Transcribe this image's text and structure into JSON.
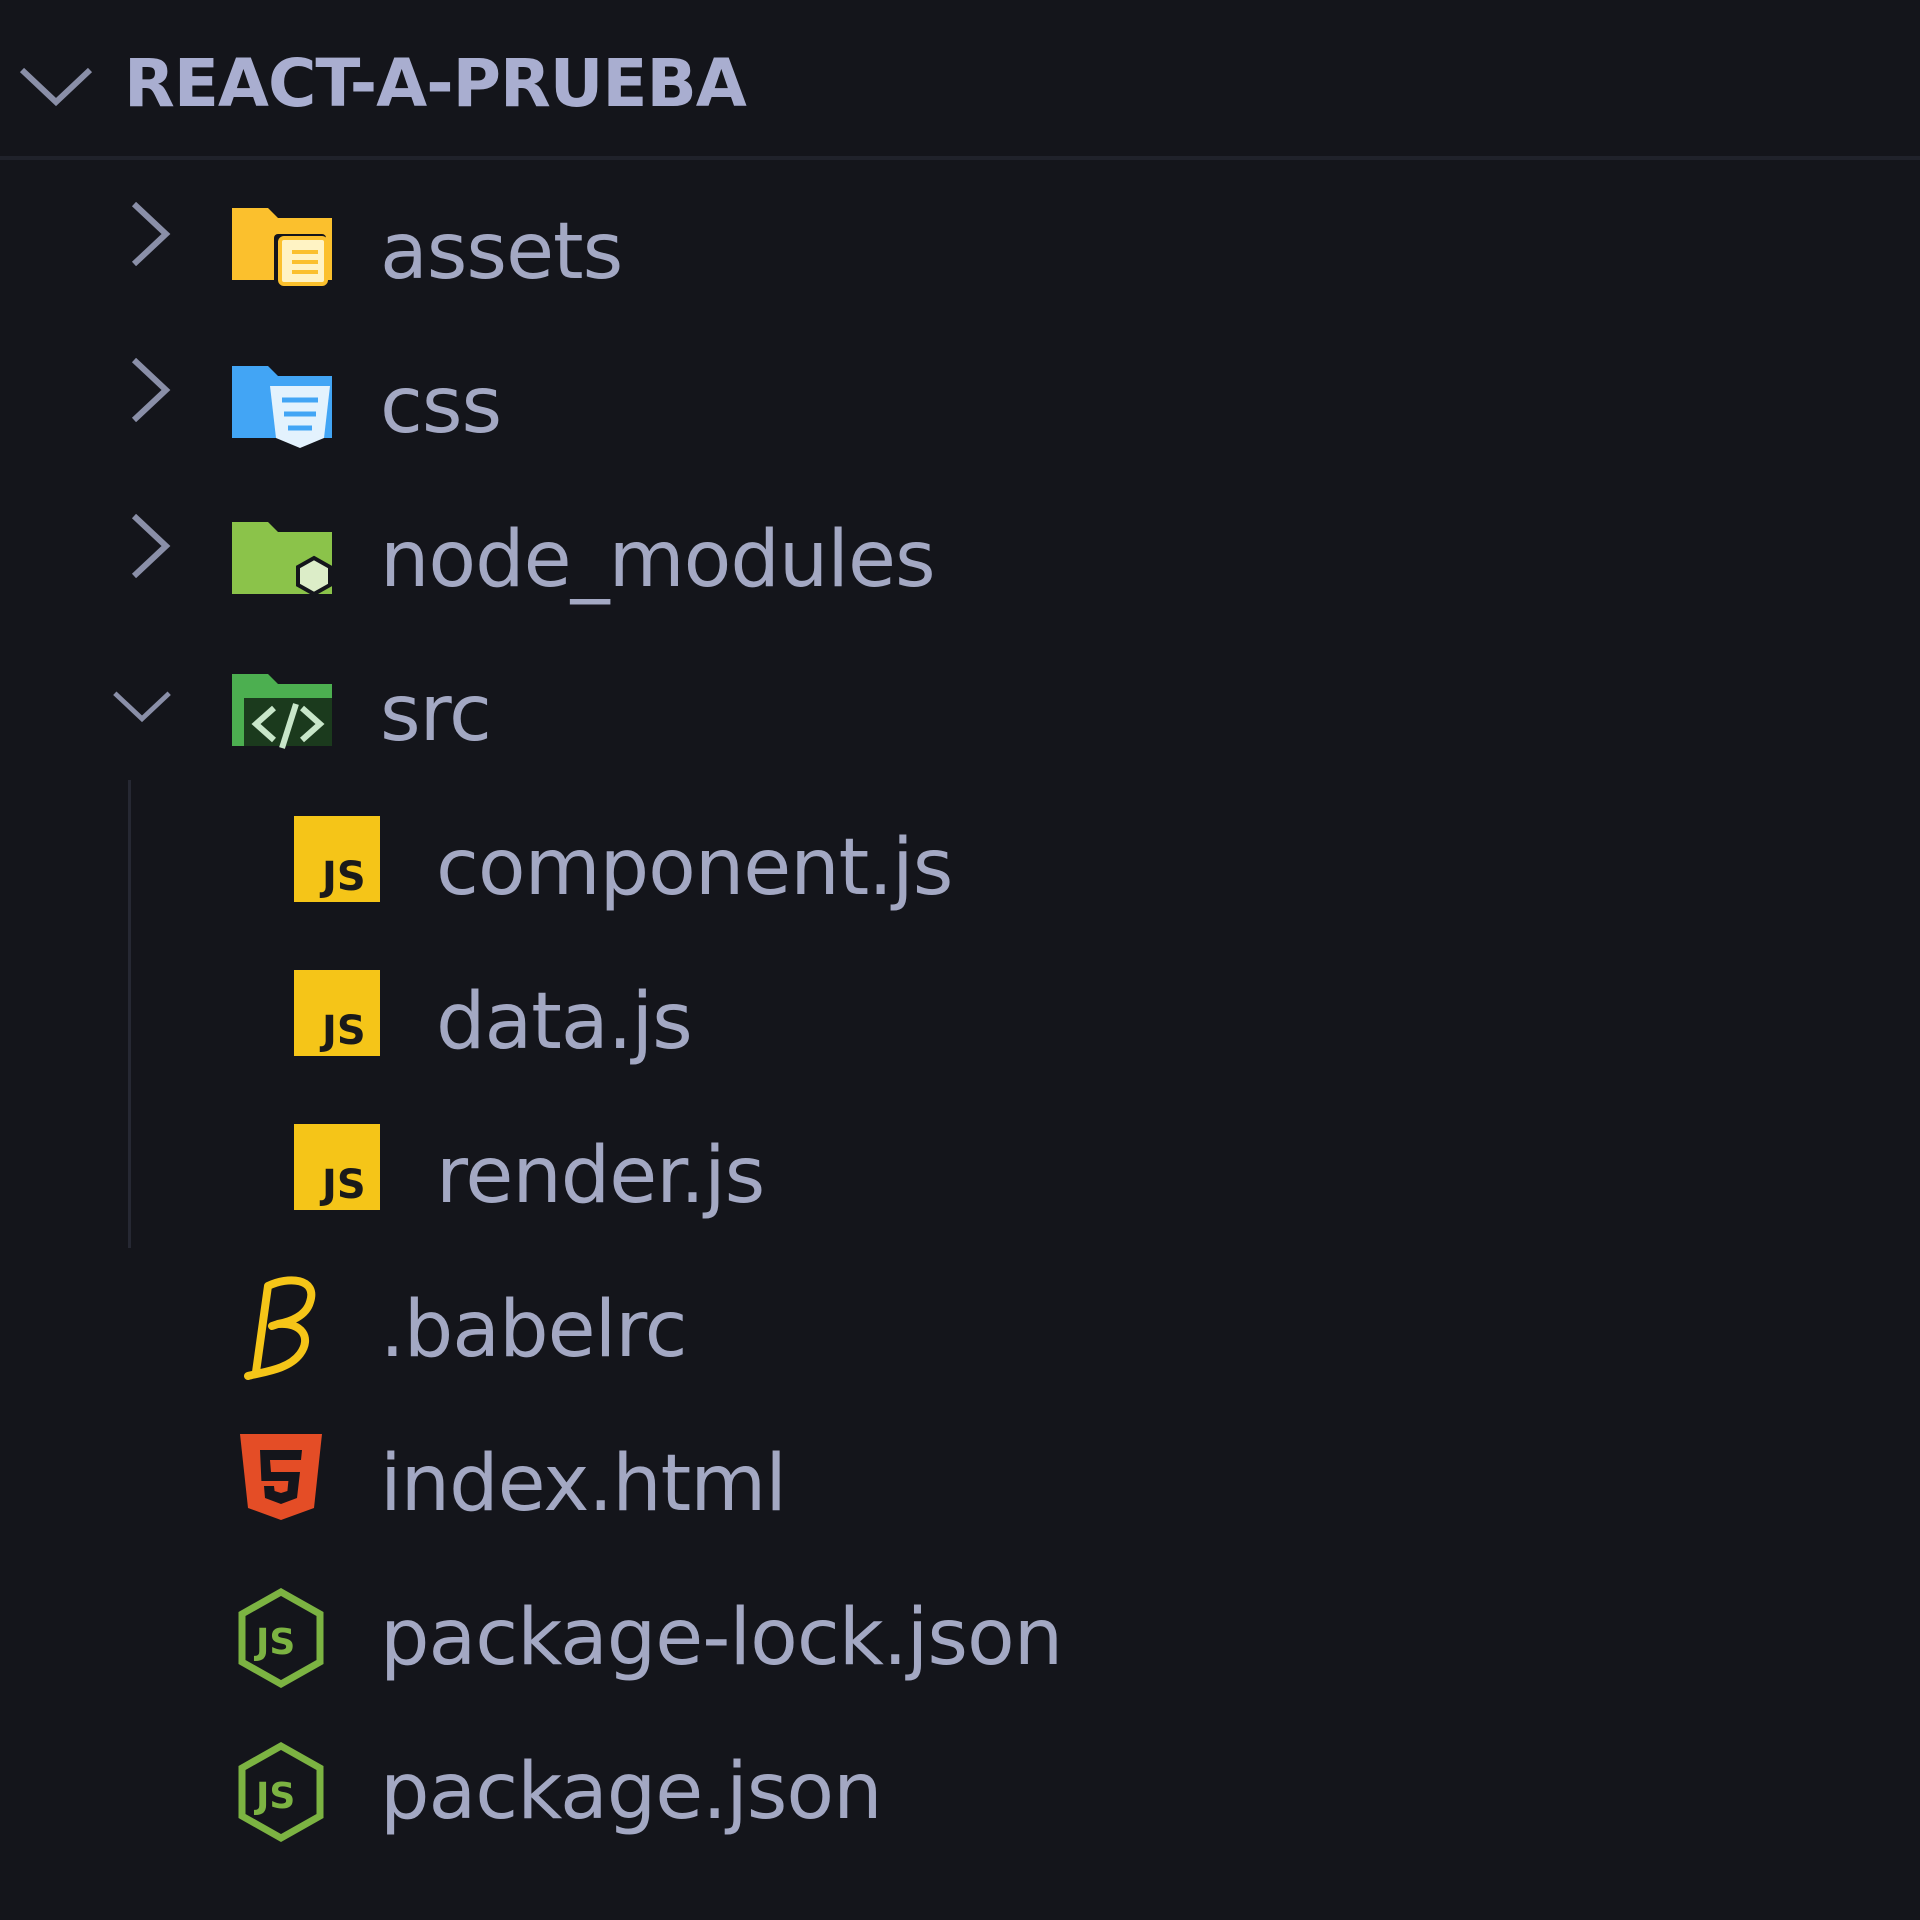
{
  "explorer": {
    "title": "REACT-A-PRUEBA",
    "items": [
      {
        "label": "assets",
        "kind": "folder",
        "icon": "folder-assets-icon",
        "expanded": false,
        "depth": 1
      },
      {
        "label": "css",
        "kind": "folder",
        "icon": "folder-css-icon",
        "expanded": false,
        "depth": 1
      },
      {
        "label": "node_modules",
        "kind": "folder",
        "icon": "folder-node-icon",
        "expanded": false,
        "depth": 1
      },
      {
        "label": "src",
        "kind": "folder",
        "icon": "folder-src-icon",
        "expanded": true,
        "depth": 1
      },
      {
        "label": "component.js",
        "kind": "file",
        "icon": "javascript-file-icon",
        "depth": 2
      },
      {
        "label": "data.js",
        "kind": "file",
        "icon": "javascript-file-icon",
        "depth": 2
      },
      {
        "label": "render.js",
        "kind": "file",
        "icon": "javascript-file-icon",
        "depth": 2
      },
      {
        "label": ".babelrc",
        "kind": "file",
        "icon": "babel-file-icon",
        "depth": 1
      },
      {
        "label": "index.html",
        "kind": "file",
        "icon": "html5-file-icon",
        "depth": 1
      },
      {
        "label": "package-lock.json",
        "kind": "file",
        "icon": "nodejs-file-icon",
        "depth": 1
      },
      {
        "label": "package.json",
        "kind": "file",
        "icon": "nodejs-file-icon",
        "depth": 1
      }
    ]
  },
  "colors": {
    "background": "#14151b",
    "text": "#a3a8c3",
    "title": "#a9aed0",
    "js_yellow": "#f5c518",
    "html_orange": "#e44d26",
    "node_green": "#7cb342",
    "folder_yellow": "#fbc02d",
    "folder_blue": "#42a5f5",
    "folder_green": "#8bc34a",
    "src_green": "#4caf50"
  }
}
